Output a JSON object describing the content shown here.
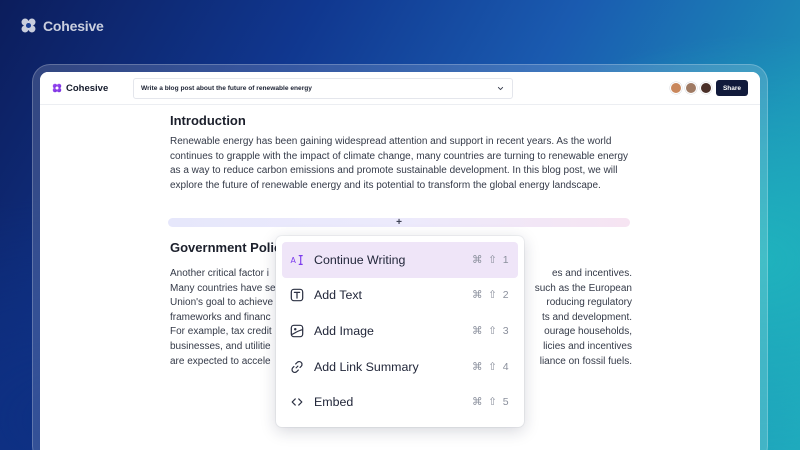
{
  "background_brand": {
    "name": "Cohesive",
    "logo_icon": "cohesive-logo-icon"
  },
  "app": {
    "brand_name": "Cohesive",
    "logo_icon": "cohesive-logo-icon",
    "accent": "#7c3aed",
    "prompt": {
      "value": "Write a blog post about the future of renewable energy",
      "chevron_icon": "chevron-down-icon"
    },
    "collaborators": [
      {
        "color": "#c9875c"
      },
      {
        "color": "#9f7a63"
      },
      {
        "color": "#4a2f28"
      }
    ],
    "share_label": "Share"
  },
  "document": {
    "section1": {
      "heading": "Introduction",
      "body": "Renewable energy has been gaining widespread attention and support in recent years. As the world continues to grapple with the impact of climate change, many countries are turning to renewable energy as a way to reduce carbon emissions and promote sustainable development. In this blog post, we will explore the future of renewable energy and its potential to transform the global energy landscape."
    },
    "insert_label": "+",
    "section2": {
      "heading": "Government Polic",
      "lines": [
        {
          "left": "Another critical factor i",
          "right": "es and incentives."
        },
        {
          "left": "Many countries have se",
          "right": "such as the European"
        },
        {
          "left": "Union's goal to achieve",
          "right": "roducing regulatory"
        },
        {
          "left": "frameworks and financ",
          "right": "ts and development."
        },
        {
          "left": "For example, tax credit",
          "right": "ourage households,"
        },
        {
          "left": "businesses, and utilitie",
          "right": "licies and incentives"
        },
        {
          "left": "are expected to accele",
          "right": "liance on fossil fuels."
        }
      ]
    }
  },
  "command_menu": {
    "items": [
      {
        "label": "Continue Writing",
        "icon": "ai-text-icon",
        "shortcut": "⌘ ⇧ 1",
        "active": true
      },
      {
        "label": "Add Text",
        "icon": "text-box-icon",
        "shortcut": "⌘ ⇧ 2",
        "active": false
      },
      {
        "label": "Add Image",
        "icon": "image-icon",
        "shortcut": "⌘ ⇧ 3",
        "active": false
      },
      {
        "label": "Add Link Summary",
        "icon": "link-icon",
        "shortcut": "⌘ ⇧ 4",
        "active": false
      },
      {
        "label": "Embed",
        "icon": "code-icon",
        "shortcut": "⌘ ⇧ 5",
        "active": false
      }
    ]
  }
}
